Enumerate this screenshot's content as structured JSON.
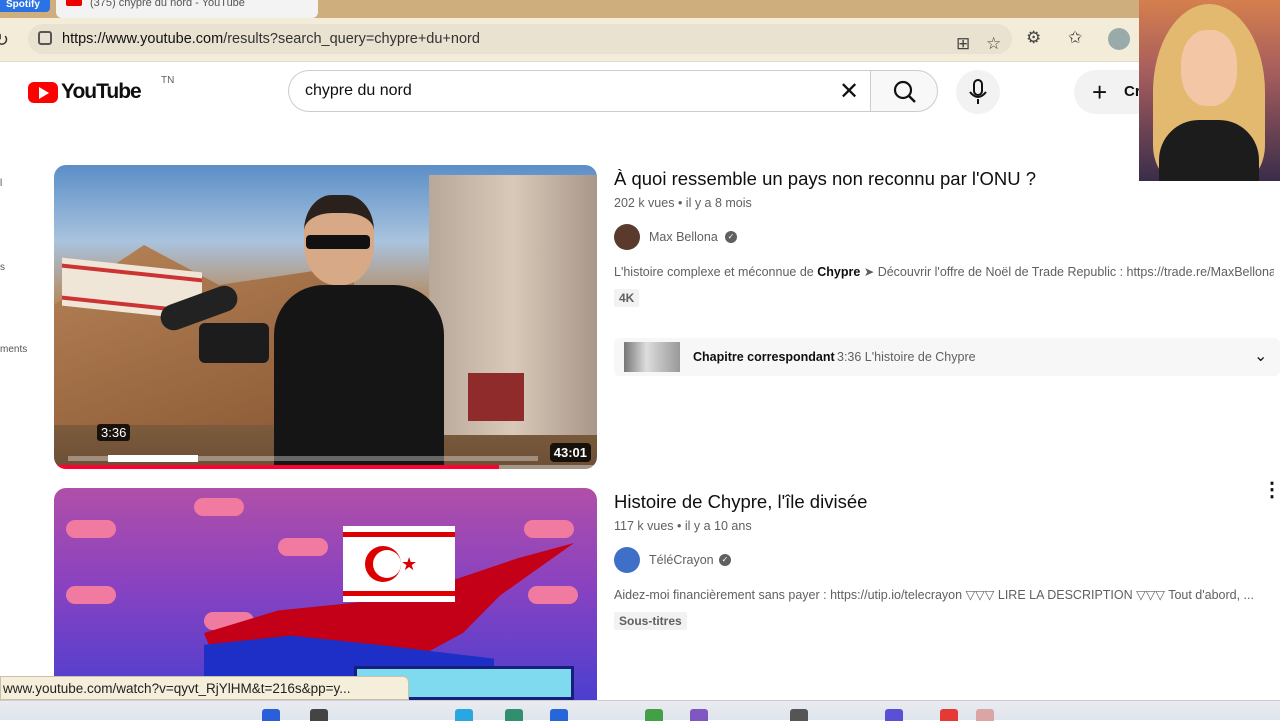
{
  "browser": {
    "tabs": [
      {
        "label": "Spotify"
      },
      {
        "label": "(375) chypre du nord - YouTube"
      }
    ],
    "url_host": "https://www.youtube.com",
    "url_path": "/results?search_query=chypre+du+nord",
    "status_url": "www.youtube.com/watch?v=qyvt_RjYlHM&t=216s&pp=y..."
  },
  "youtube": {
    "logo_text": "YouTube",
    "country_code": "TN",
    "search_value": "chypre du nord",
    "create_label": "Cr"
  },
  "sidebar_fragments": [
    "l",
    "s",
    "ments"
  ],
  "results": [
    {
      "title": "À quoi ressemble un pays non reconnu par l'ONU ?",
      "views": "202 k vues",
      "age": "il y a 8 mois",
      "channel": "Max Bellona",
      "desc_pre": "L'histoire complexe et méconnue de ",
      "desc_bold": "Chypre",
      "desc_post": " ➤ Découvrir l'offre de Noël de Trade Republic : https://trade.re/MaxBellona",
      "badge": "4K",
      "duration": "43:01",
      "hover_time": "3:36",
      "chapter_label": "Chapitre correspondant",
      "chapter_detail": "3:36 L'histoire de Chypre",
      "watched_fraction": 0.82
    },
    {
      "title": "Histoire de Chypre, l'île divisée",
      "views": "117 k vues",
      "age": "il y a 10 ans",
      "channel": "TéléCrayon",
      "desc": "Aidez-moi financièrement sans payer : https://utip.io/telecrayon ▽▽▽ LIRE LA DESCRIPTION ▽▽▽ Tout d'abord, ...",
      "badge": "Sous-titres"
    }
  ],
  "colors": {
    "youtube_red": "#ff0000",
    "tab_bar": "#cfae7e",
    "address_bar": "#f3ecd9"
  }
}
